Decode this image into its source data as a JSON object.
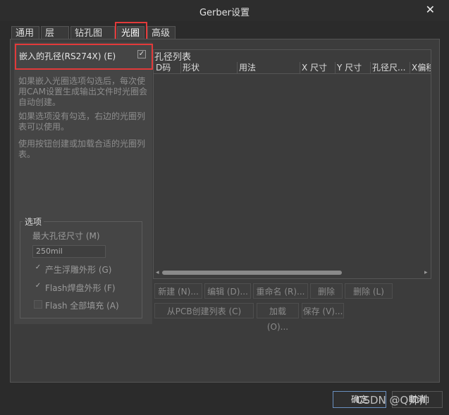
{
  "window": {
    "title": "Gerber设置",
    "close_glyph": "✕"
  },
  "tabs": [
    {
      "label": "通用"
    },
    {
      "label": "层"
    },
    {
      "label": "钻孔图层"
    },
    {
      "label": "光圈"
    },
    {
      "label": "高级"
    }
  ],
  "left": {
    "embed_label": "嵌入的孔径(RS274X) (E)",
    "embed_checked": "✓",
    "help1": "如果嵌入光圈选项勾选后，每次使用CAM设置生成输出文件时光圈会自动创建。",
    "help2": "如果选项没有勾选，右边的光圈列表可以使用。",
    "help3": "使用按钮创建或加载合适的光圈列表。",
    "options_title": "选项",
    "max_size_label": "最大孔径尺寸 (M)",
    "max_size_value": "250mil",
    "opt1": "产生浮雕外形 (G)",
    "opt2": "Flash焊盘外形 (F)",
    "opt3": "Flash 全部填充 (A)"
  },
  "list": {
    "title": "孔径列表",
    "columns": [
      "D码",
      "形状",
      "用法",
      "X 尺寸",
      "Y 尺寸",
      "孔径尺...",
      "X偏移"
    ]
  },
  "buttons": {
    "new": "新建 (N)...",
    "edit": "编辑 (D)...",
    "rename": "重命名 (R)...",
    "delete_e": "删除 (E)...",
    "delete_l": "删除 (L)",
    "from_pcb": "从PCB创建列表 (C)",
    "load": "加载 (O)...",
    "save": "保存 (V)...",
    "ok": "确定",
    "cancel": "取消"
  },
  "watermark": "CSDN @Q帅帅"
}
